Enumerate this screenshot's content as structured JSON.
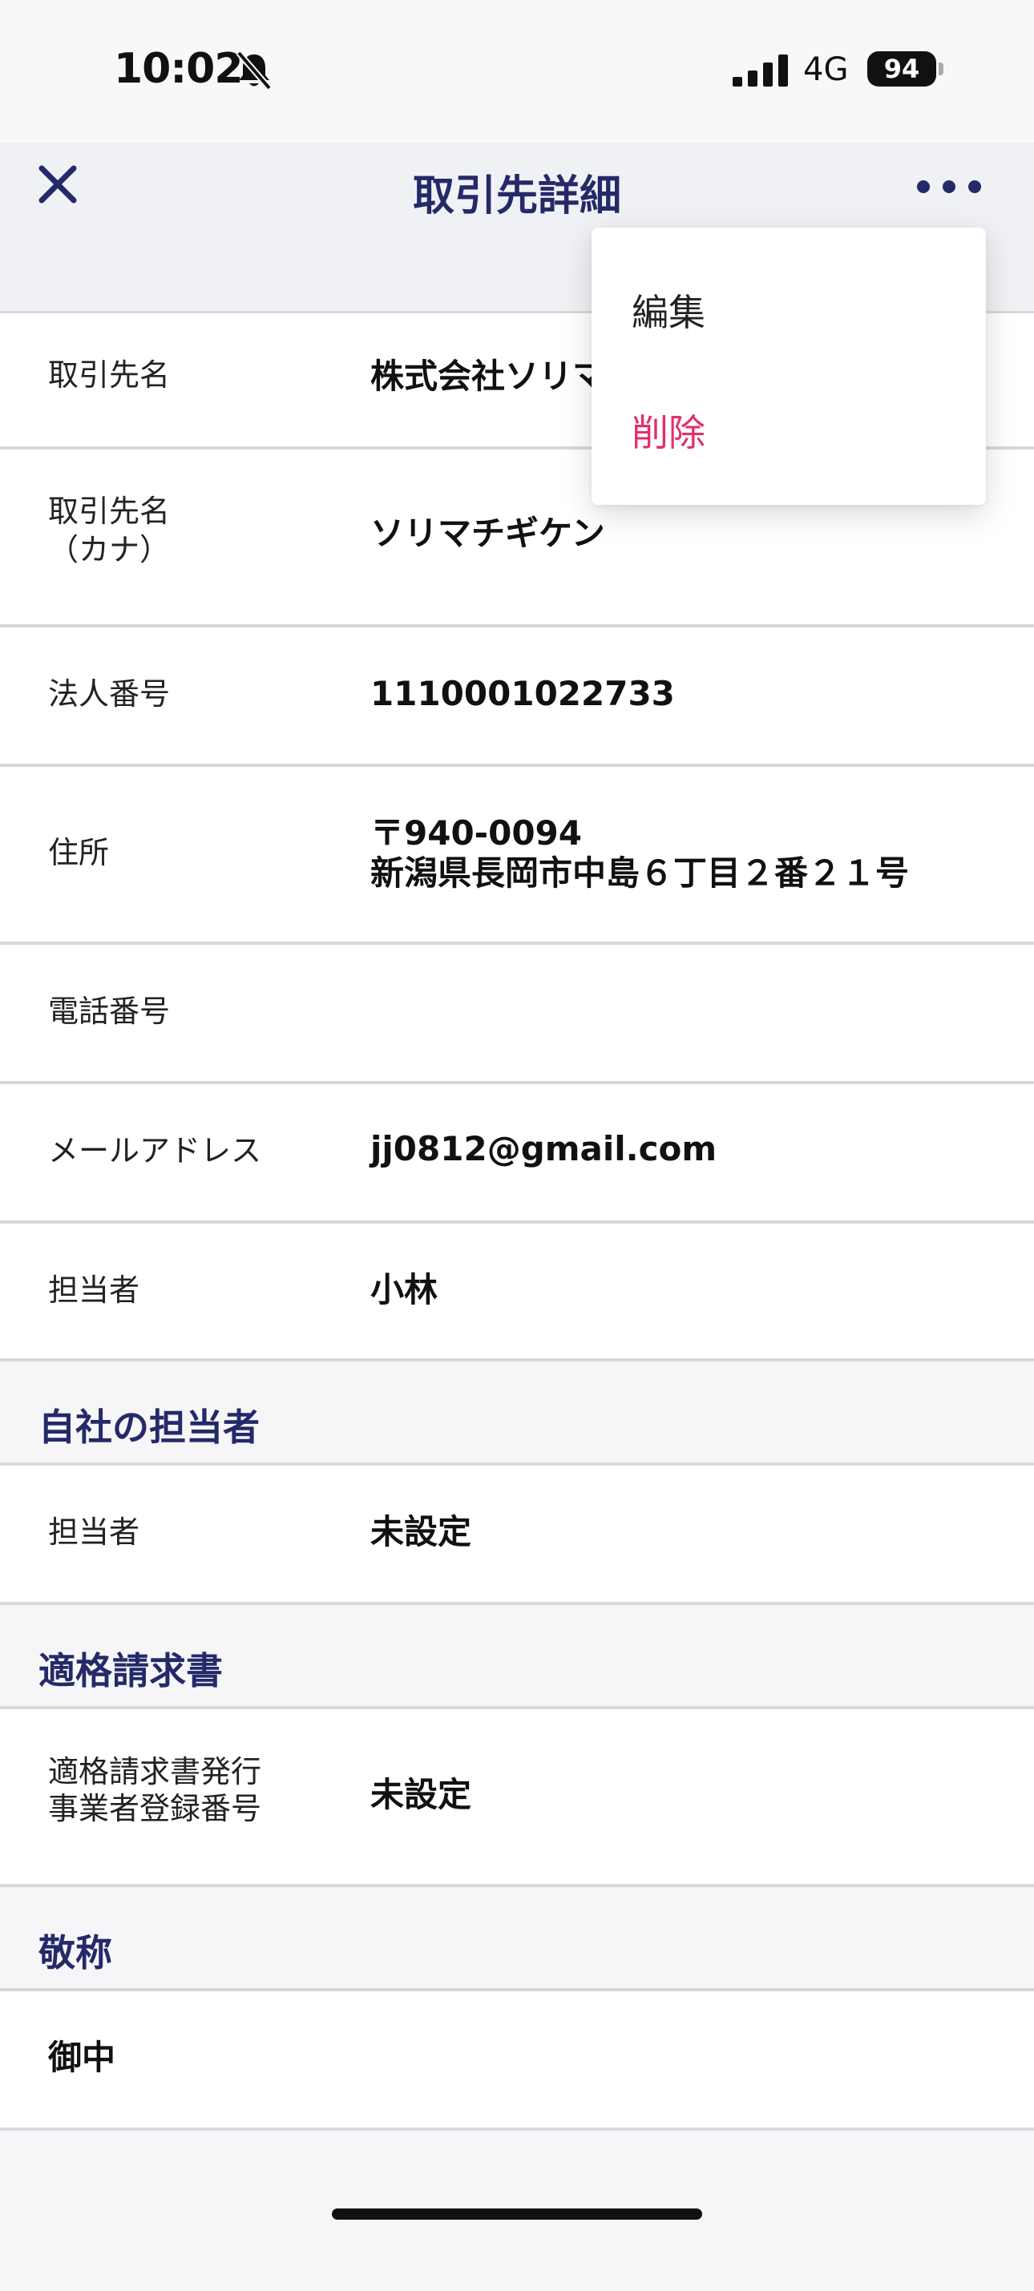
{
  "status": {
    "time": "10:02",
    "network": "4G",
    "battery": "94"
  },
  "nav": {
    "title": "取引先詳細"
  },
  "menu": {
    "edit": "編集",
    "delete": "削除"
  },
  "fields": [
    {
      "label": "取引先名",
      "value": "株式会社ソリマ"
    },
    {
      "label": "取引先名\n（カナ）",
      "value": "ソリマチギケン"
    },
    {
      "label": "法人番号",
      "value": "1110001022733"
    },
    {
      "label": "住所",
      "value": "〒940-0094\n新潟県長岡市中島６丁目２番２１号"
    },
    {
      "label": "電話番号",
      "value": ""
    },
    {
      "label": "メールアドレス",
      "value": "jj0812@gmail.com"
    },
    {
      "label": "担当者",
      "value": "小林"
    }
  ],
  "own_staff": {
    "title": "自社の担当者",
    "label": "担当者",
    "value": "未設定"
  },
  "invoice": {
    "title": "適格請求書",
    "label": "適格請求書発行\n事業者登録番号",
    "value": "未設定"
  },
  "honorific": {
    "title": "敬称",
    "value": "御中"
  }
}
